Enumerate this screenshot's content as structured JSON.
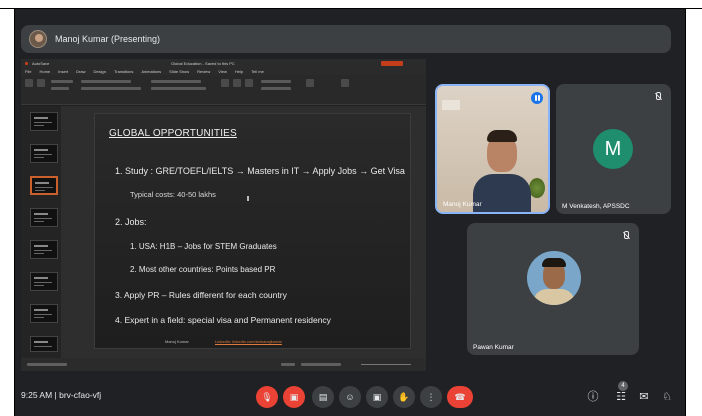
{
  "presenter": {
    "name": "Manoj Kumar (Presenting)"
  },
  "ppt": {
    "app_label": "AutoSave",
    "doc_title": "Global Education - Saved to this PC",
    "menu": [
      "File",
      "Home",
      "Insert",
      "Draw",
      "Design",
      "Transitions",
      "Animations",
      "Slide Show",
      "Review",
      "View",
      "Help",
      "Tell me"
    ]
  },
  "slide": {
    "title": "GLOBAL OPPORTUNITIES",
    "line1": "1. Study : GRE/TOEFL/IELTS → Masters in IT → Apply Jobs → Get Visa",
    "line2": "Typical costs: 40-50 lakhs",
    "line3": "2. Jobs:",
    "line4": "1. USA: H1B – Jobs for STEM Graduates",
    "line5": "2. Most other countries: Points based PR",
    "line6": "3. Apply PR – Rules different for each country",
    "line7": "4. Expert in a field: special visa and Permanent residency",
    "footer_name": "Manoj Kumar",
    "footer_link": "LinkedIn: linkedin.com/in/manojkumar"
  },
  "participants": [
    {
      "name": "Manoj Kumar"
    },
    {
      "name": "M Venkatesh, APSSDC",
      "initial": "M"
    },
    {
      "name": "Pawan Kumar"
    }
  ],
  "meeting": {
    "info": "9:25 AM | brv-cfao-vfj"
  },
  "controls": {
    "mic_icon": "🎙",
    "cam_icon": "▣",
    "cc_icon": "▤",
    "emoji_icon": "☺",
    "present_icon": "▣",
    "hand_icon": "✋",
    "more_icon": "⋮",
    "end_icon": "☎"
  },
  "right_icons": {
    "info_icon": "ⓘ",
    "people_icon": "☷",
    "chat_icon": "✉",
    "activities_icon": "♘",
    "people_count": "4"
  },
  "colors": {
    "accent": "#8ab4f8",
    "end_call": "#ea4335",
    "background": "#202124",
    "avatar": "#1e8e6e"
  }
}
